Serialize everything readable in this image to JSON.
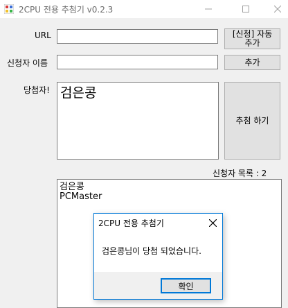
{
  "window": {
    "title": "2CPU 전용 추첨기 v0.2.3"
  },
  "form": {
    "url_label": "URL",
    "url_value": "",
    "applicant_label": "신청자 이름",
    "applicant_value": "",
    "auto_add_line1": "[신청] 자동",
    "auto_add_line2": "추가",
    "add_button": "추가",
    "winner_label": "당첨자!",
    "winner_value": "검은콩",
    "draw_button": "추첨 하기",
    "applicant_count": "신청자 목록 : 2"
  },
  "applicants": [
    "검은콩",
    "PCMaster"
  ],
  "dialog": {
    "title": "2CPU 전용 추첨기",
    "message": "검은콩님이 당첨 되었습니다.",
    "ok_button": "확인"
  }
}
